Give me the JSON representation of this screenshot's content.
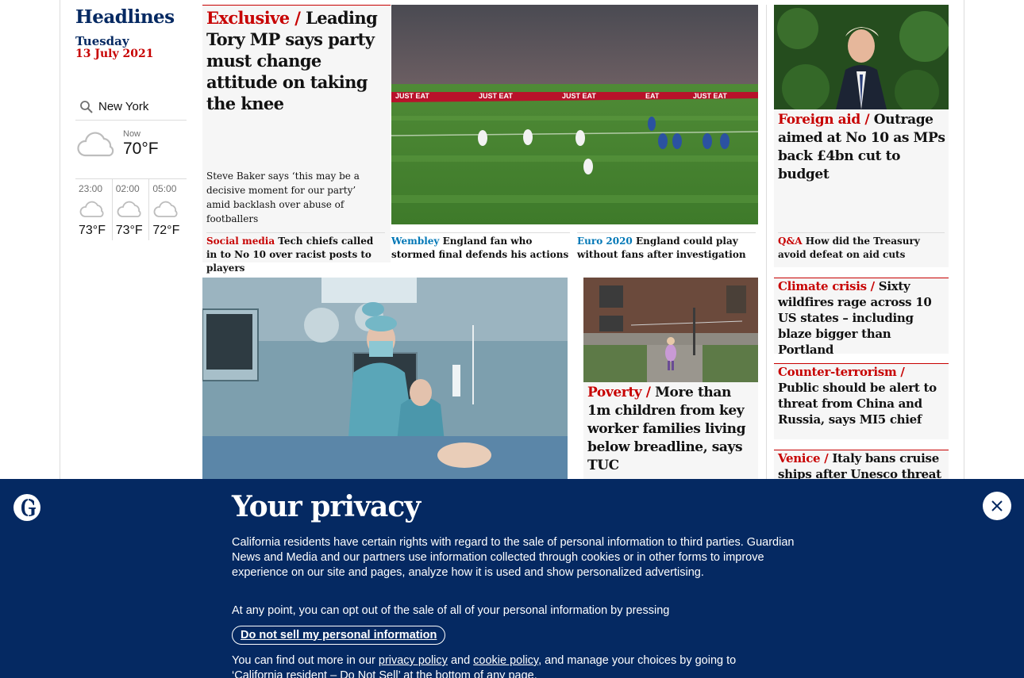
{
  "section": {
    "title": "Headlines",
    "day": "Tuesday",
    "date": "13 July 2021"
  },
  "weather": {
    "location": "New York",
    "now_label": "Now",
    "now_temp": "70°F",
    "forecast": [
      {
        "time": "23:00",
        "temp": "73°F",
        "icon": "cloud-icon"
      },
      {
        "time": "02:00",
        "temp": "73°F",
        "icon": "cloud-icon"
      },
      {
        "time": "05:00",
        "temp": "72°F",
        "icon": "cloud-icon"
      }
    ]
  },
  "main_story": {
    "kicker": "Exclusive /",
    "headline": "Leading Tory MP says party must change attitude on taking the knee",
    "standfirst": "Steve Baker says ‘this may be a decisive moment for our party’ amid backlash over abuse of footballers",
    "sublinks": [
      {
        "kicker": "Social media",
        "text": "Tech chiefs called in to No 10 over racist posts to players"
      },
      {
        "kicker": "Wembley",
        "text": "England fan who stormed final defends his actions"
      },
      {
        "kicker": "Euro 2020",
        "text": "England could play without fans after investigation"
      }
    ],
    "photo_boards": [
      "JUST EAT",
      "JUST EAT",
      "JUST EAT",
      "EAT",
      "JUST EAT"
    ]
  },
  "right_story": {
    "kicker": "Foreign aid /",
    "headline": "Outrage aimed at No 10 as MPs back £4bn cut to budget",
    "sub_kicker": "Q&A",
    "sub_text": "How did the Treasury avoid defeat on aid cuts"
  },
  "poverty_story": {
    "kicker": "Poverty /",
    "headline": "More than 1m children from key worker families living below breadline, says TUC"
  },
  "small_stories": [
    {
      "kicker": "Climate crisis  /",
      "headline": "Sixty wildfires rage across 10 US states – including blaze bigger than Portland"
    },
    {
      "kicker": "Counter-terrorism /",
      "headline": "Public should be alert to threat from China and Russia, says MI5 chief"
    },
    {
      "kicker": "Venice /",
      "headline": "Italy bans cruise ships after Unesco threat"
    }
  ],
  "privacy": {
    "title": "Your privacy",
    "p1": "California residents have certain rights with regard to the sale of personal information to third parties. Guardian News and Media and our partners use information collected through cookies or in other forms to improve experience on our site and pages, analyze how it is used and show personalized advertising.",
    "p2": "At any point, you can opt out of the sale of all of your personal information by pressing",
    "button": "Do not sell my personal information",
    "p3_start": "You can find out more in our",
    "link1": "privacy policy",
    "p3_and": "and",
    "link2": "cookie policy",
    "p3_end": ", and manage your choices by going to ‘California resident – Do Not Sell’ at the bottom of any page."
  },
  "colors": {
    "brand_blue": "#052962",
    "news_red": "#c70000",
    "sport_blue": "#0077b6"
  }
}
